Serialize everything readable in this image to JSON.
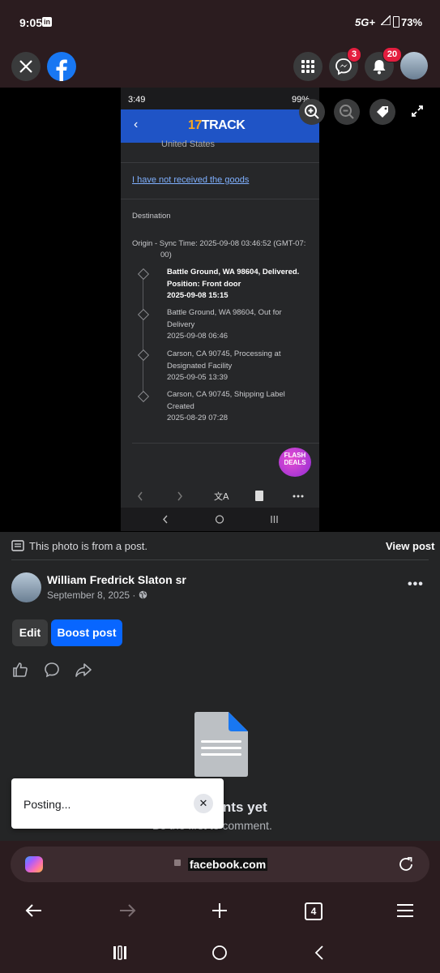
{
  "status_bar": {
    "time": "9:05",
    "network": "5G+",
    "battery": "73%"
  },
  "header": {
    "messenger_badge": "3",
    "notifications_badge": "20"
  },
  "screenshot": {
    "status_time": "3:49",
    "status_battery": "99%",
    "brand_prefix": "17",
    "brand_suffix": "TRACK",
    "country": "United States",
    "not_received_link": "I have not received the goods",
    "destination_label": "Destination",
    "origin_line1": "Origin - Sync Time: 2025-09-08 03:46:52 (GMT-07:",
    "origin_line2": "00)",
    "events": [
      {
        "line1": "Battle Ground, WA 98604, Delivered.",
        "line2": "Position: Front door",
        "line3": "2025-09-08 15:15"
      },
      {
        "line1": "Battle Ground, WA 98604, Out for",
        "line2": "Delivery",
        "line3": "2025-09-08 06:46"
      },
      {
        "line1": "Carson, CA 90745, Processing at",
        "line2": "Designated Facility",
        "line3": "2025-09-05 13:39"
      },
      {
        "line1": "Carson, CA 90745, Shipping Label",
        "line2": "Created",
        "line3": "2025-08-29 07:28"
      }
    ],
    "flash_line1": "FLASH",
    "flash_line2": "DEALS"
  },
  "post": {
    "from_post_text": "This photo is from a post.",
    "view_post": "View post",
    "author": "William Fredrick Slaton sr",
    "date": "September 8, 2025 · ",
    "edit_label": "Edit",
    "boost_label": "Boost post",
    "no_comments": "No comments yet",
    "first_comment": "Be the first to comment."
  },
  "toast": {
    "text": "Posting..."
  },
  "browser": {
    "url": "facebook.com",
    "tab_count": "4"
  }
}
